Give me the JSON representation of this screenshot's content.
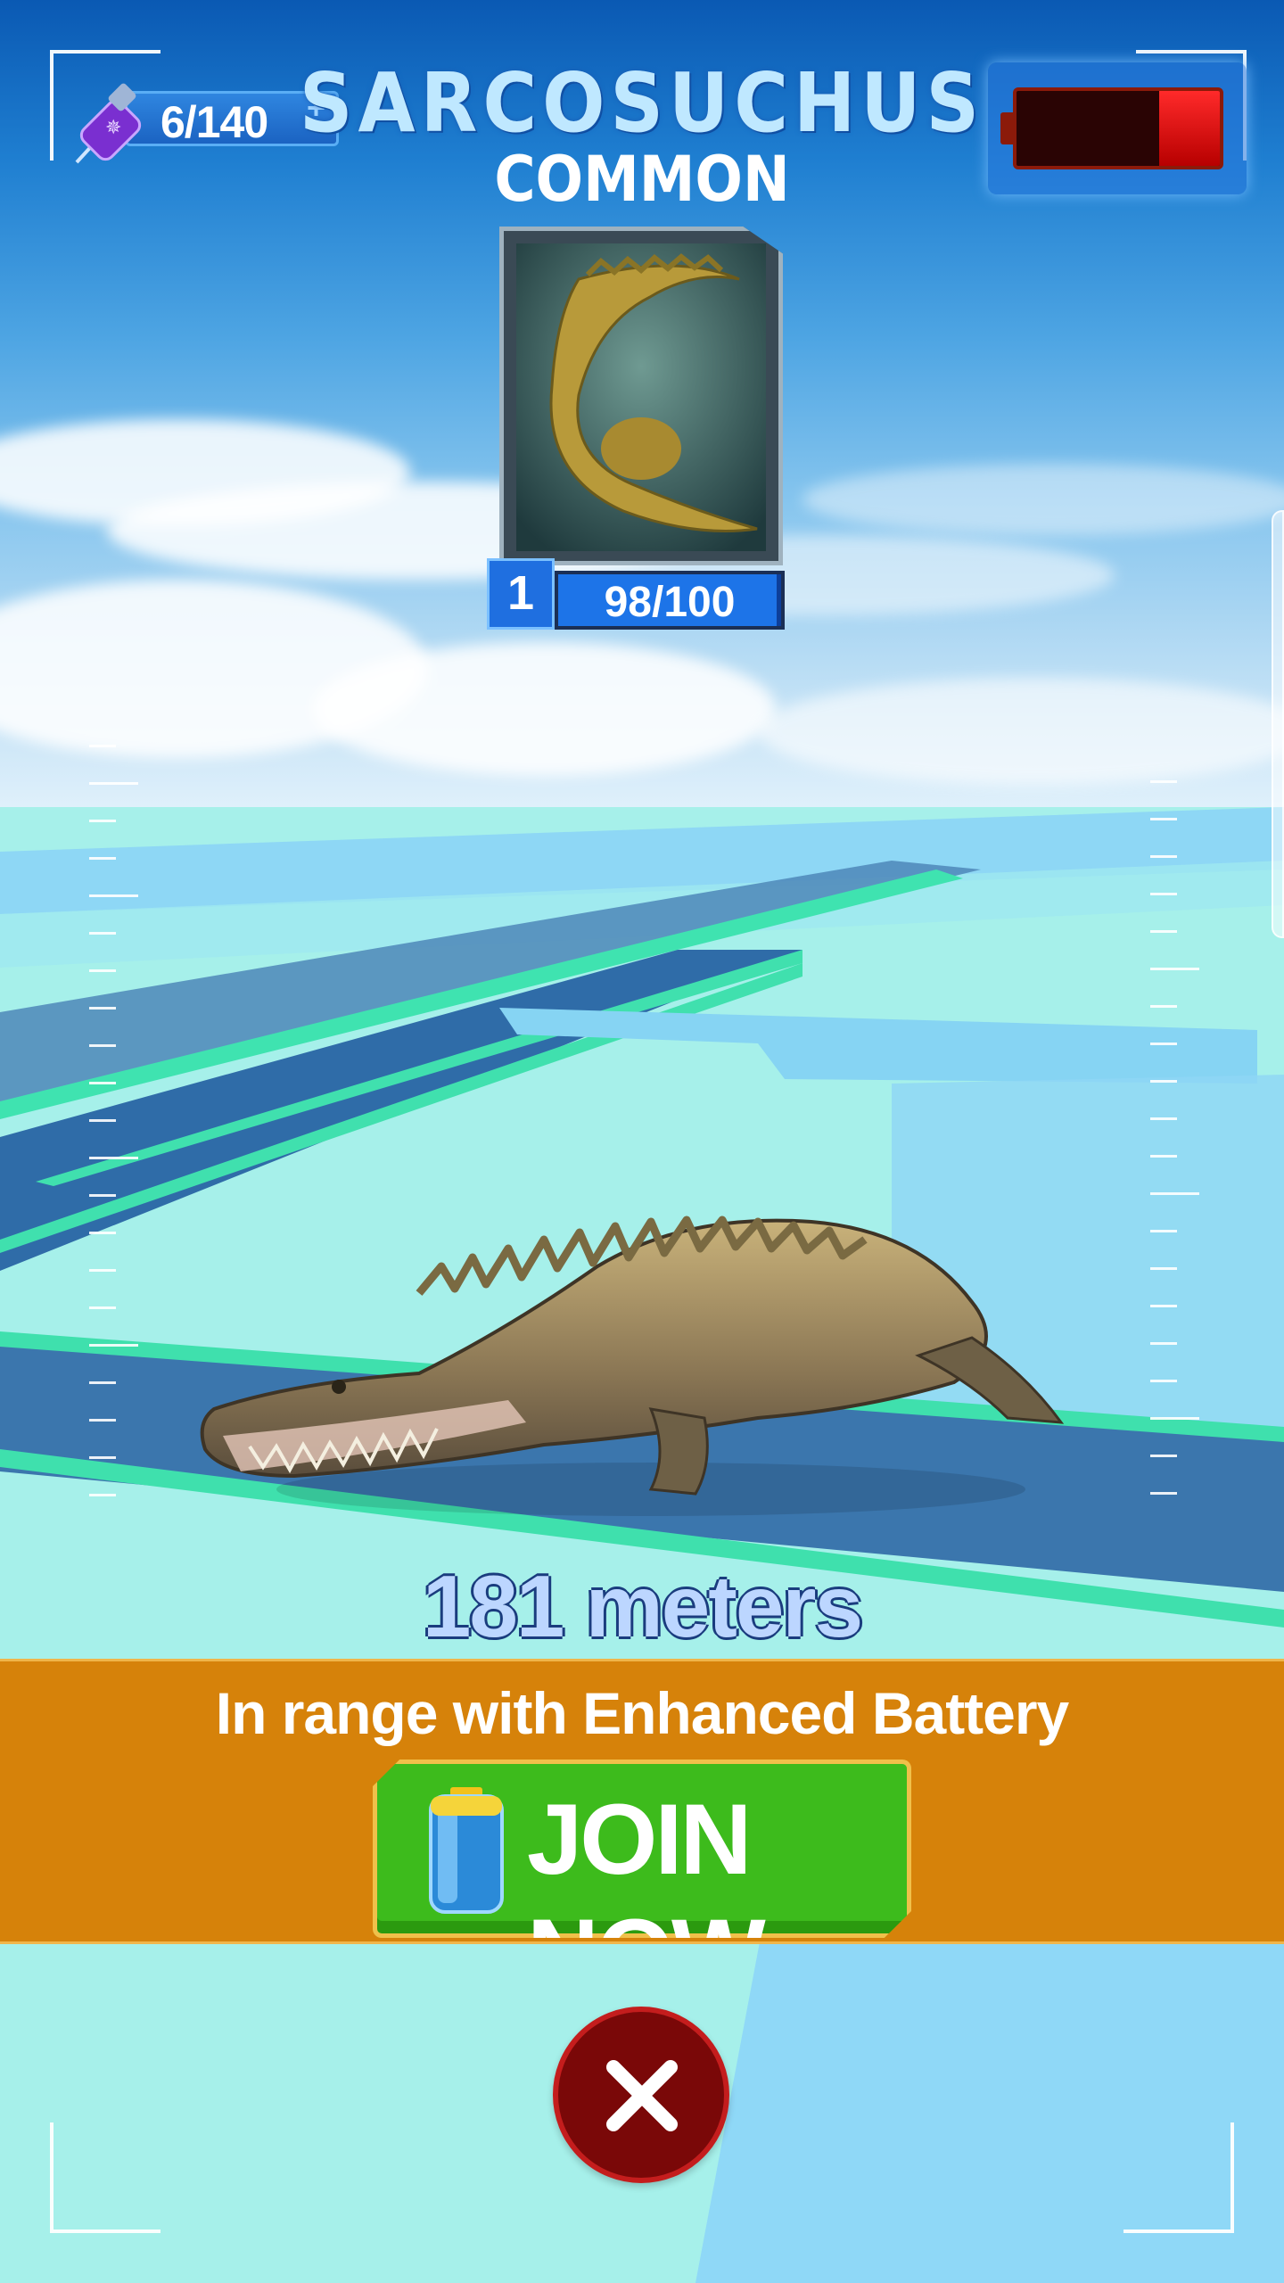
{
  "header": {
    "dna_counter": "6/140",
    "dna_plus": "+",
    "creature_name": "SARCOSUCHUS",
    "rarity": "COMMON",
    "battery_level": 0.3
  },
  "card": {
    "level": "1",
    "progress_text": "98/100",
    "progress_fraction": 0.98
  },
  "distance": "181 meters",
  "banner": {
    "message": "In range with Enhanced Battery",
    "join_label": "JOIN NOW"
  },
  "icons": {
    "dna_icon": "syringe-icon",
    "battery_icon": "battery-icon",
    "join_icon": "battery-cell-icon",
    "close_icon": "close-icon"
  },
  "colors": {
    "banner": "#d6820a",
    "join_button": "#3dbb1c",
    "close_button": "#7a0808",
    "battery_fill": "#e00000"
  }
}
